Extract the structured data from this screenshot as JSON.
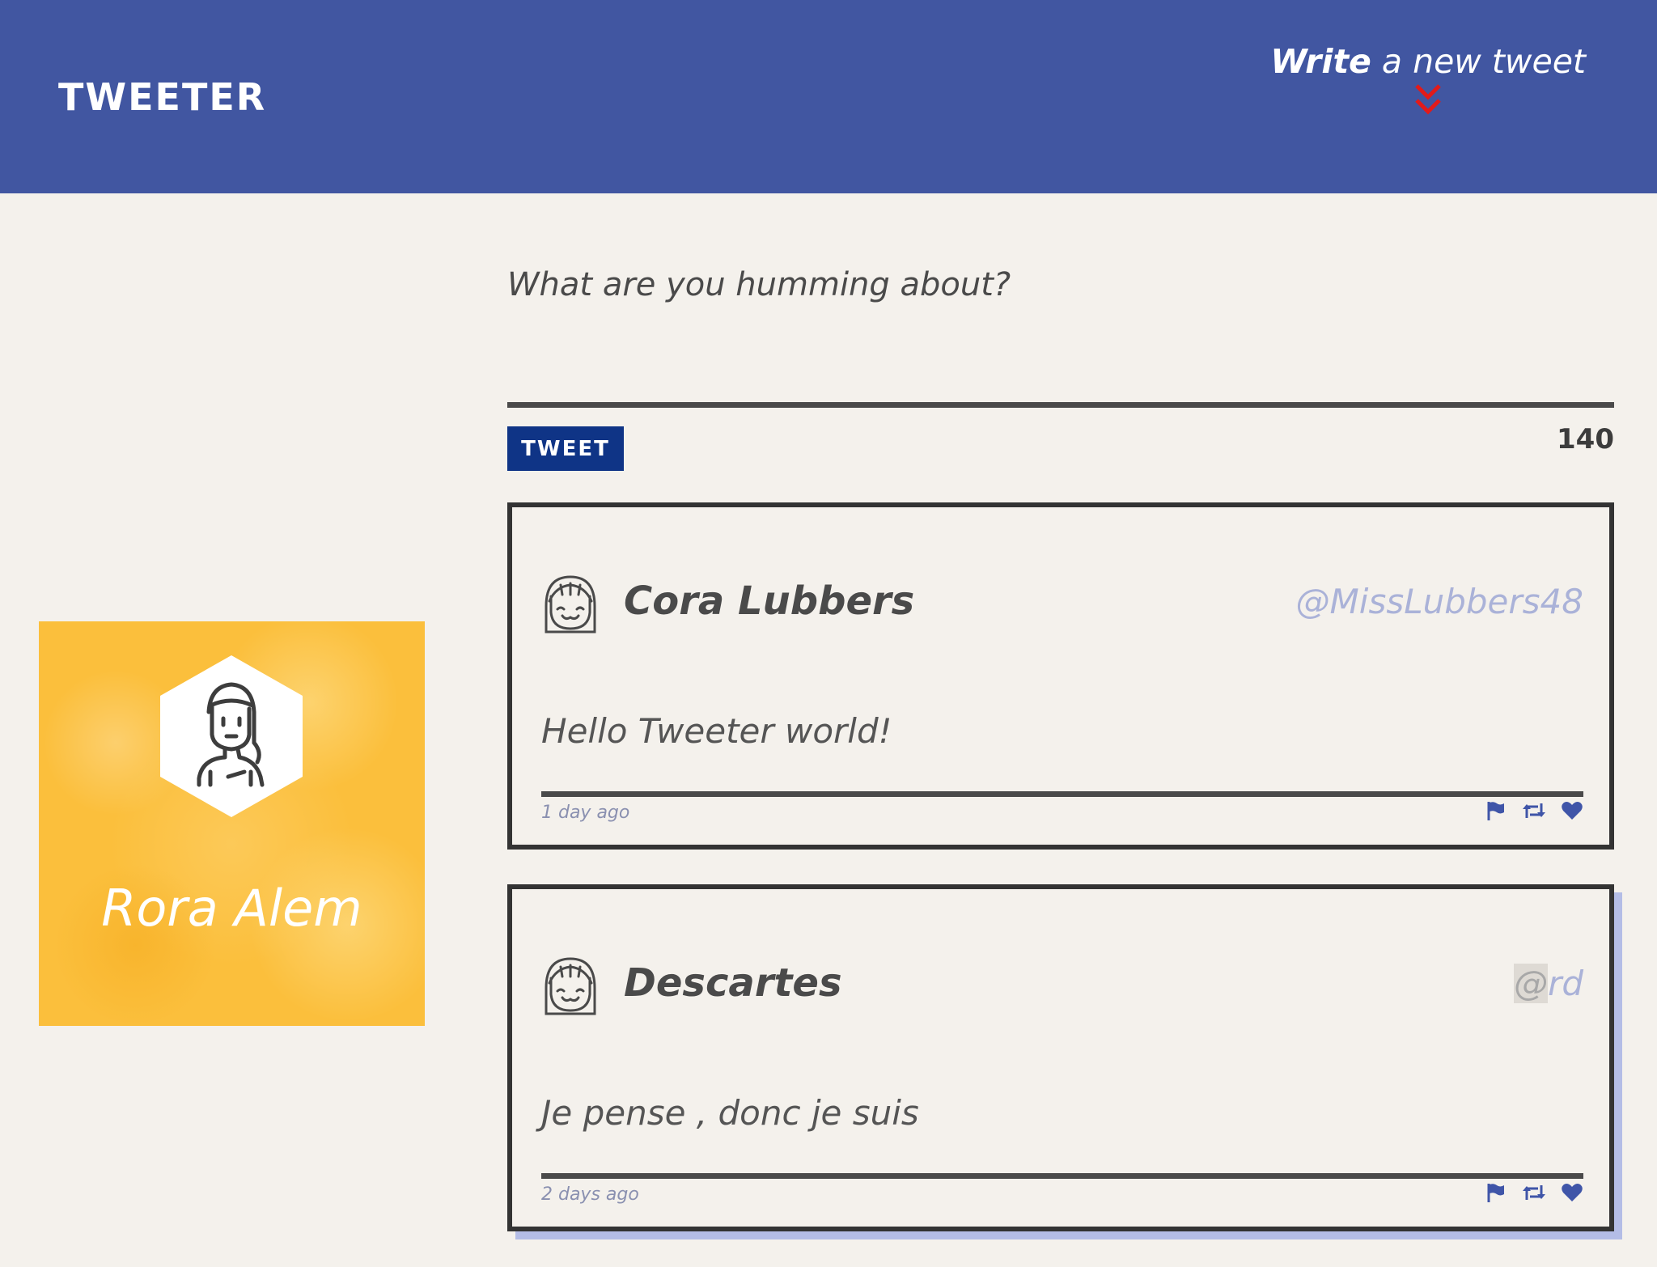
{
  "header": {
    "logo": "TWEETER",
    "compose_toggle": {
      "bold": "Write",
      "rest": "a new tweet"
    },
    "chevron_color": "#e21a1a"
  },
  "profile": {
    "name": "Rora Alem",
    "avatar_icon": "person-icon"
  },
  "composer": {
    "placeholder": "What are you humming about?",
    "value": "",
    "button_label": "TWEET",
    "counter": "140"
  },
  "tweets": [
    {
      "author": "Cora Lubbers",
      "handle": "@MissLubbers48",
      "text": "Hello Tweeter world!",
      "time": "1 day ago"
    },
    {
      "author": "Descartes",
      "handle_at": "@",
      "handle_rest": "rd",
      "text": "Je pense , donc je suis",
      "time": "2 days ago"
    }
  ],
  "icons": [
    "flag-icon",
    "retweet-icon",
    "heart-icon"
  ],
  "colors": {
    "nav": "#4156a1",
    "button": "#0f3486",
    "background": "#f4f1ec",
    "profile": "#fbbf3c",
    "accent_icons": "#3f55a8"
  }
}
